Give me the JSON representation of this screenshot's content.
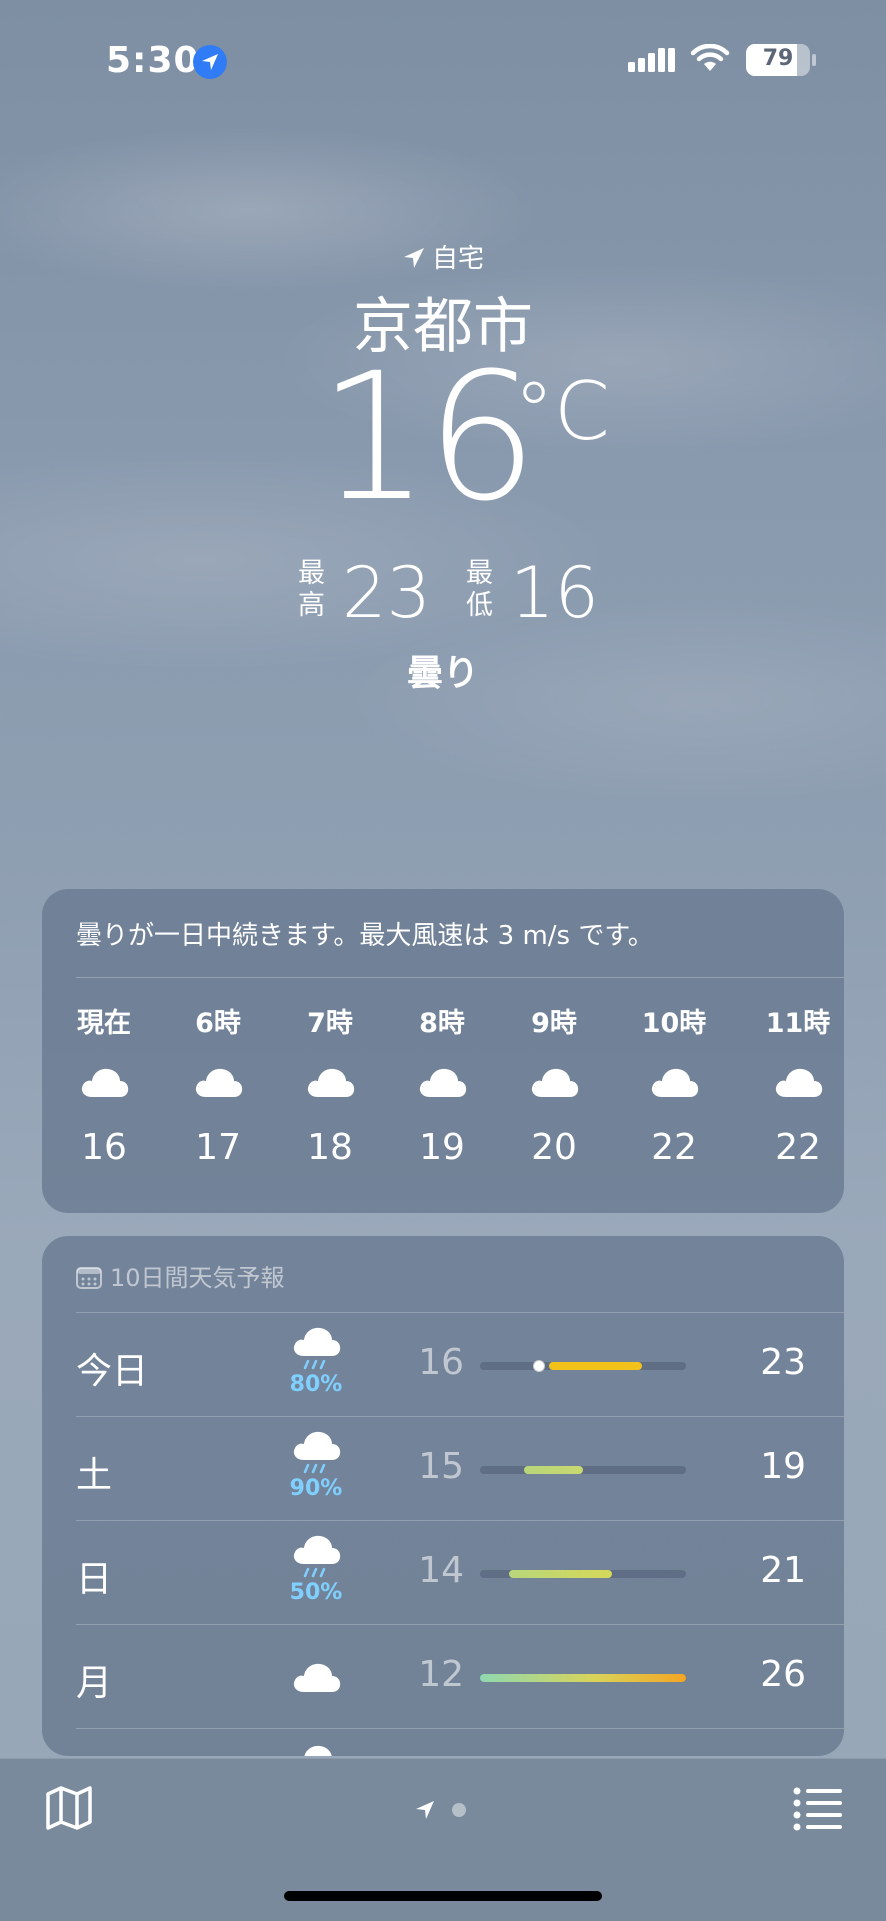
{
  "status_bar": {
    "time": "5:30",
    "battery": "79",
    "battery_level": 0.79
  },
  "header": {
    "home_label": "自宅",
    "city": "京都市",
    "temperature": "16",
    "unit": "°C",
    "high_label": "最高",
    "high": "23",
    "low_label": "最低",
    "low": "16",
    "condition": "曇り"
  },
  "hourly": {
    "summary": "曇りが一日中続きます。最大風速は 3 m/s です。",
    "items": [
      {
        "label": "現在",
        "icon": "cloud-icon",
        "temp": "16"
      },
      {
        "label": "6時",
        "icon": "cloud-icon",
        "temp": "17"
      },
      {
        "label": "7時",
        "icon": "cloud-icon",
        "temp": "18"
      },
      {
        "label": "8時",
        "icon": "cloud-icon",
        "temp": "19"
      },
      {
        "label": "9時",
        "icon": "cloud-icon",
        "temp": "20"
      },
      {
        "label": "10時",
        "icon": "cloud-icon",
        "temp": "22"
      },
      {
        "label": "11時",
        "icon": "cloud-icon",
        "temp": "22"
      }
    ]
  },
  "daily": {
    "title": "10日間天気予報",
    "range_min": 12,
    "range_max": 26,
    "days": [
      {
        "day": "今日",
        "icon": "cloud-rain-icon",
        "precip": "80%",
        "low": "16",
        "high": "23",
        "current": 16
      },
      {
        "day": "土",
        "icon": "cloud-rain-icon",
        "precip": "90%",
        "low": "15",
        "high": "19"
      },
      {
        "day": "日",
        "icon": "cloud-rain-icon",
        "precip": "50%",
        "low": "14",
        "high": "21"
      },
      {
        "day": "月",
        "icon": "cloud-icon",
        "precip": "",
        "low": "12",
        "high": "26"
      }
    ]
  },
  "colors": {
    "accent_blue": "#2f7cf6",
    "precip_blue": "#7fd0ff",
    "bar_yellow": "#f2c21b",
    "bar_green": "#b8d67a",
    "bar_orange": "#f5a623",
    "bar_teal": "#8fd8b0"
  }
}
